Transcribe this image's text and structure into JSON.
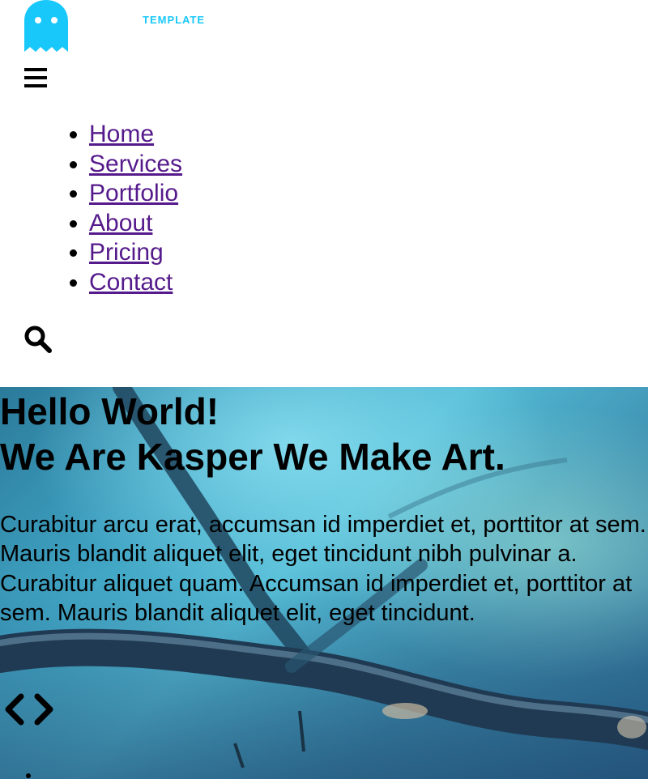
{
  "header": {
    "logo_icon": "ghost-icon",
    "logo_text": "TEMPLATE",
    "brand_color": "#19c8fa",
    "menu_icon": "hamburger-icon",
    "search_icon": "search-icon"
  },
  "nav": {
    "items": [
      {
        "label": "Home"
      },
      {
        "label": "Services"
      },
      {
        "label": "Portfolio"
      },
      {
        "label": "About"
      },
      {
        "label": "Pricing"
      },
      {
        "label": "Contact"
      }
    ],
    "link_color": "#551a8b"
  },
  "hero": {
    "title_line1": "Hello World!",
    "title_line2": "We Are Kasper We Make Art.",
    "text": "Curabitur arcu erat, accumsan id imperdiet et, porttitor at sem. Mauris blandit aliquet elit, eget tincidunt nibh pulvinar a. Curabitur aliquet quam. Accumsan id imperdiet et, porttitor at sem. Mauris blandit aliquet elit, eget tincidunt.",
    "prev_icon": "chevron-left-icon",
    "next_icon": "chevron-right-icon"
  }
}
